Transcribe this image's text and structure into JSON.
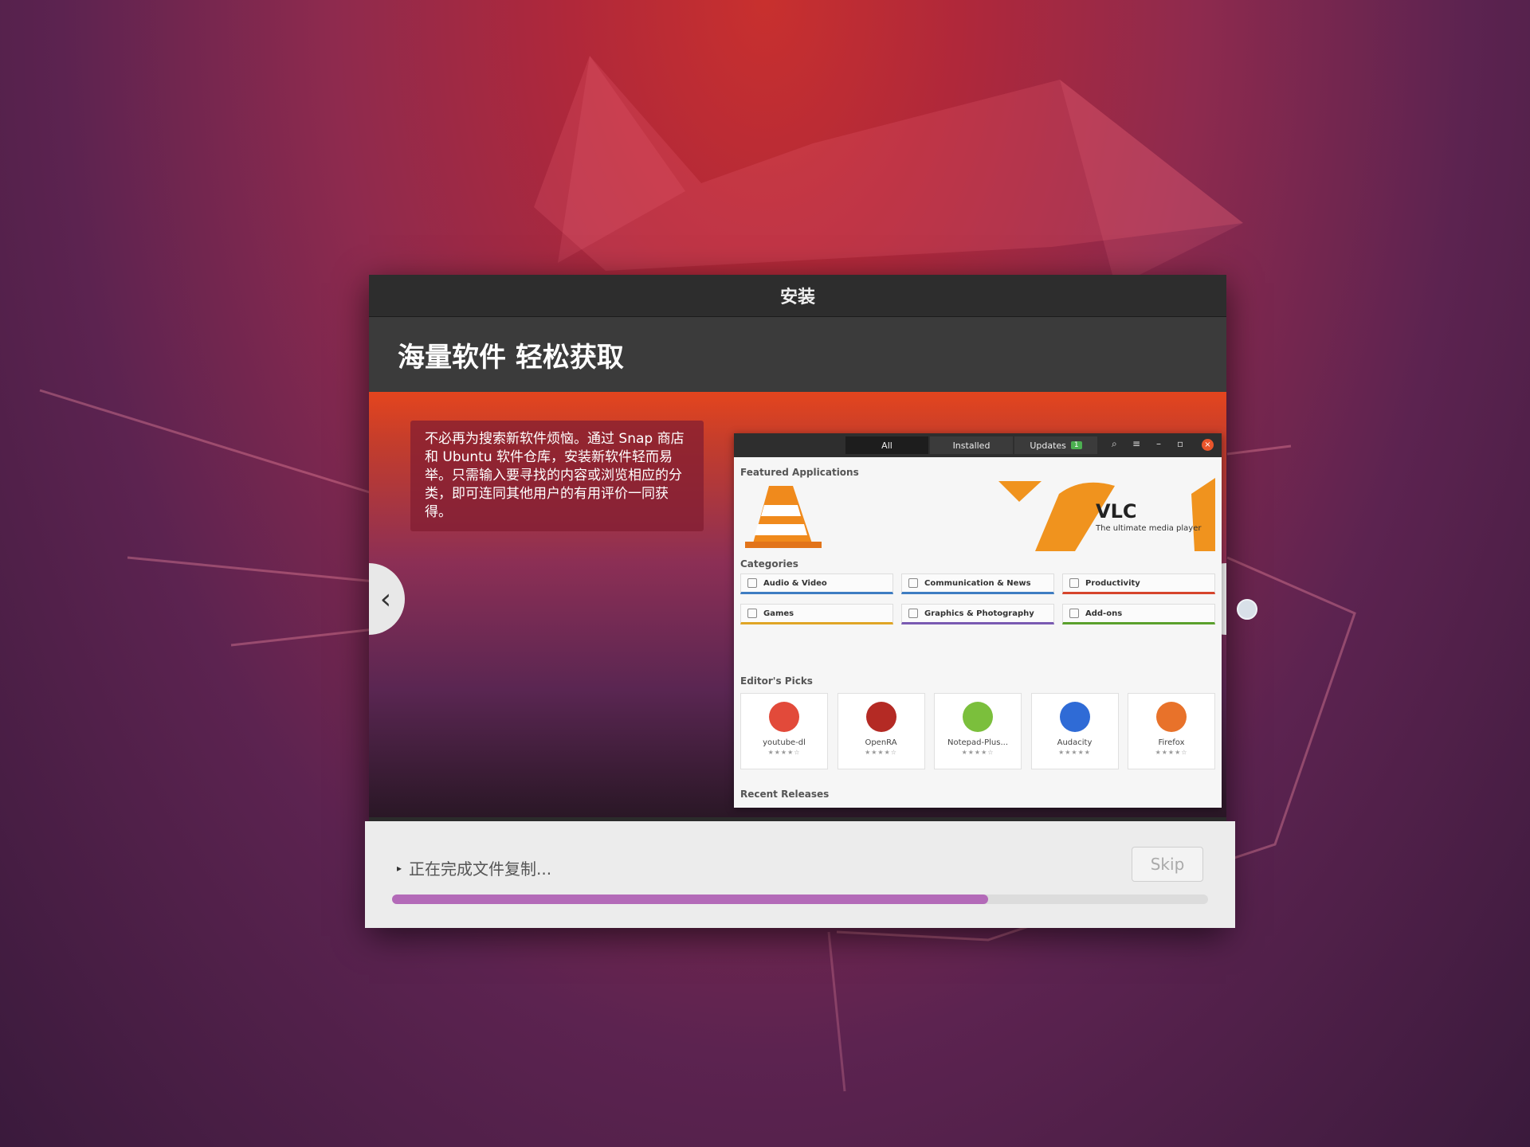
{
  "window": {
    "title": "安装"
  },
  "slide": {
    "headline": "海量软件 轻松获取",
    "description": "不必再为搜索新软件烦恼。通过 Snap 商店和 Ubuntu 软件仓库，安装新软件轻而易举。只需输入要寻找的内容或浏览相应的分类，即可连同其他用户的有用评价一同获得。",
    "prev_label": "‹",
    "next_label": "›"
  },
  "software_window": {
    "tabs": [
      {
        "label": "All"
      },
      {
        "label": "Installed"
      },
      {
        "label": "Updates",
        "badge": "1"
      }
    ],
    "featured_heading": "Featured Applications",
    "featured_app": {
      "name": "VLC",
      "tagline": "The ultimate media player"
    },
    "categories_heading": "Categories",
    "categories": [
      {
        "label": "Audio & Video",
        "color": "#3e7dc2"
      },
      {
        "label": "Communication & News",
        "color": "#3e7dc2"
      },
      {
        "label": "Productivity",
        "color": "#d6452c"
      },
      {
        "label": "Games",
        "color": "#e0a526"
      },
      {
        "label": "Graphics & Photography",
        "color": "#7a5ab2"
      },
      {
        "label": "Add-ons",
        "color": "#5aa02c"
      }
    ],
    "editors_heading": "Editor's Picks",
    "picks": [
      {
        "name": "youtube-dl",
        "stars": "★★★★☆",
        "icon": "youtube-icon",
        "color": "#e24a3a"
      },
      {
        "name": "OpenRA",
        "stars": "★★★★☆",
        "icon": "openra-icon",
        "color": "#b42a24"
      },
      {
        "name": "Notepad-Plus...",
        "stars": "★★★★☆",
        "icon": "notepad-icon",
        "color": "#7bbf3c"
      },
      {
        "name": "Audacity",
        "stars": "★★★★★",
        "icon": "audacity-icon",
        "color": "#2f6bd6"
      },
      {
        "name": "Firefox",
        "stars": "★★★★☆",
        "icon": "firefox-icon",
        "color": "#e8722a"
      }
    ],
    "recent_heading": "Recent Releases"
  },
  "footer": {
    "status": "正在完成文件复制...",
    "skip_label": "Skip",
    "progress": 0.73
  }
}
